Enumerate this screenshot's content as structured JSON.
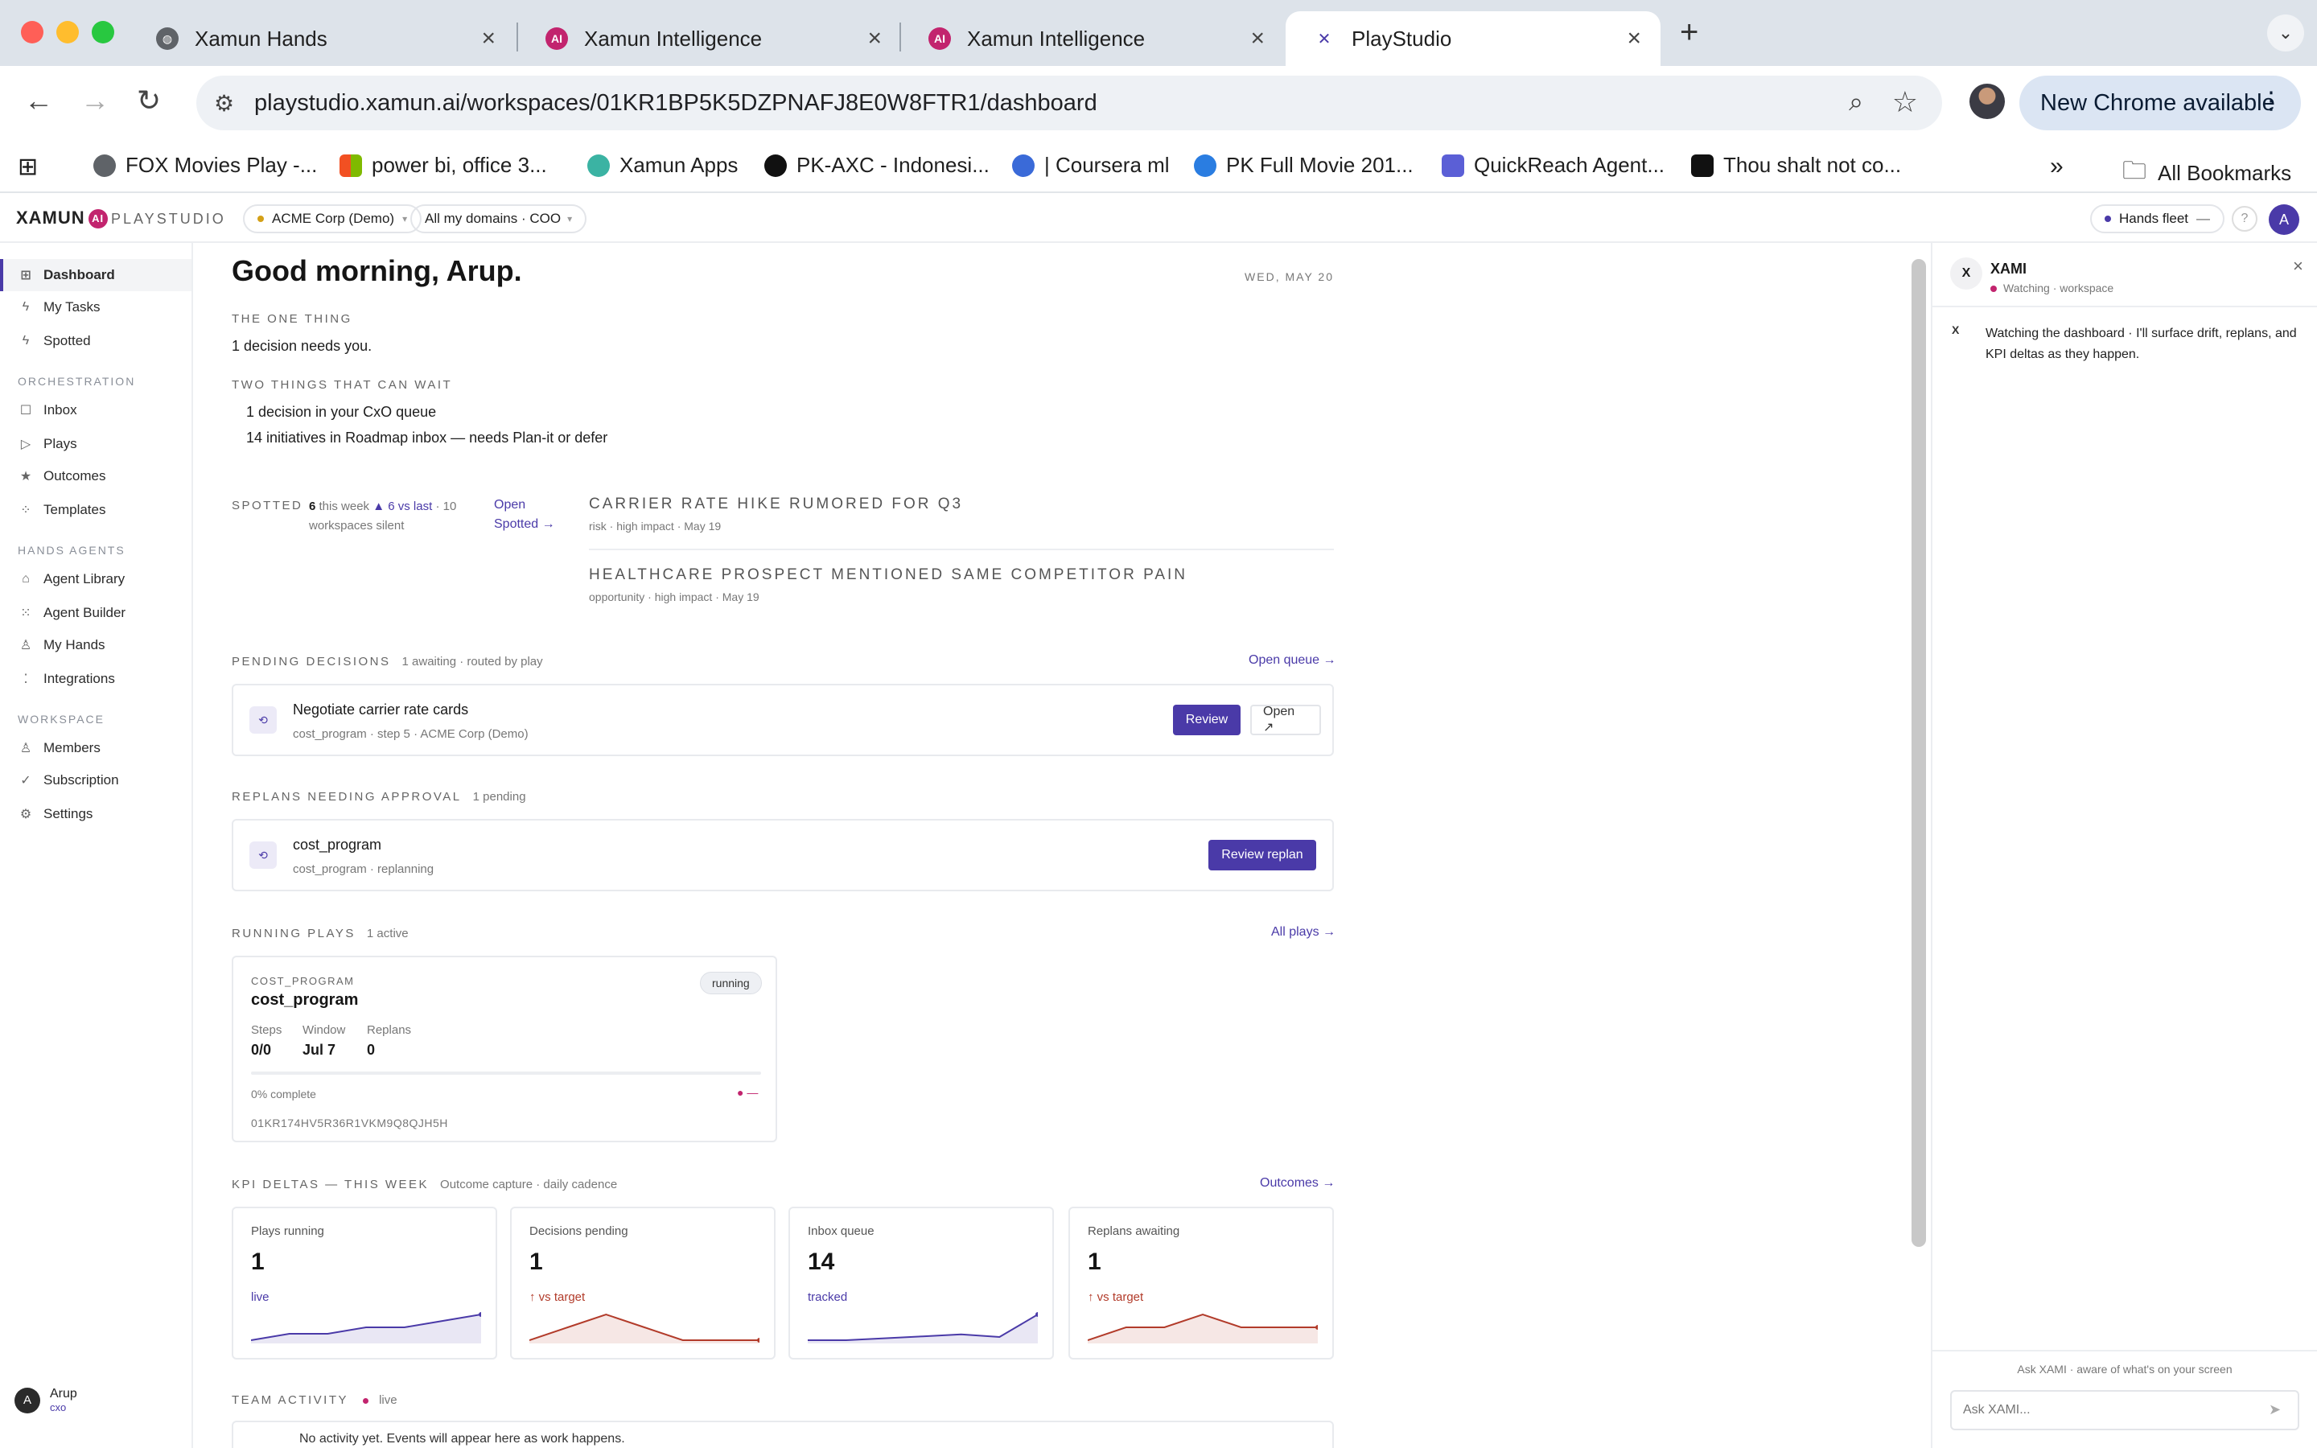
{
  "browser": {
    "tabs": [
      {
        "title": "Xamun Hands",
        "active": false
      },
      {
        "title": "Xamun Intelligence",
        "active": false
      },
      {
        "title": "Xamun Intelligence",
        "active": false
      },
      {
        "title": "PlayStudio",
        "active": true
      }
    ],
    "url": "playstudio.xamun.ai/workspaces/01KR1BP5K5DZPNAFJ8E0W8FTR1/dashboard",
    "update_button": "New Chrome available",
    "bookmarks": [
      "FOX Movies Play -...",
      "power bi, office 3...",
      "Xamun Apps",
      "PK-AXC - Indonesi...",
      "| Coursera ml",
      "PK Full Movie 201...",
      "QuickReach Agent...",
      "Thou shalt not co..."
    ],
    "all_bookmarks": "All Bookmarks"
  },
  "header": {
    "logo": "XAMUN",
    "logo_ai": "AI",
    "product": "PLAYSTUDIO",
    "org": "ACME Corp (Demo)",
    "domains": "All my domains · COO",
    "fleet": "Hands fleet",
    "fleet_status": "—",
    "user_initial": "A"
  },
  "sidebar": {
    "items": [
      {
        "label": "Dashboard",
        "icon": "grid-icon"
      },
      {
        "label": "My Tasks",
        "icon": "bolt-icon"
      },
      {
        "label": "Spotted",
        "icon": "bolt-icon"
      }
    ],
    "sections": [
      {
        "title": "ORCHESTRATION",
        "items": [
          {
            "label": "Inbox",
            "icon": "inbox-icon"
          },
          {
            "label": "Plays",
            "icon": "play-icon"
          },
          {
            "label": "Outcomes",
            "icon": "star-icon"
          },
          {
            "label": "Templates",
            "icon": "template-icon"
          }
        ]
      },
      {
        "title": "HANDS AGENTS",
        "items": [
          {
            "label": "Agent Library",
            "icon": "library-icon"
          },
          {
            "label": "Agent Builder",
            "icon": "builder-icon"
          },
          {
            "label": "My Hands",
            "icon": "user-icon"
          },
          {
            "label": "Integrations",
            "icon": "integrations-icon"
          }
        ]
      },
      {
        "title": "WORKSPACE",
        "items": [
          {
            "label": "Members",
            "icon": "members-icon"
          },
          {
            "label": "Subscription",
            "icon": "check-icon"
          },
          {
            "label": "Settings",
            "icon": "gear-icon"
          }
        ]
      }
    ],
    "user": {
      "initial": "A",
      "name": "Arup",
      "role": "cxo"
    }
  },
  "main": {
    "greeting": "Good morning, Arup.",
    "date": "WED, MAY 20",
    "one_thing": {
      "label": "THE ONE THING",
      "text": "1 decision needs you."
    },
    "can_wait": {
      "label": "TWO THINGS THAT CAN WAIT",
      "items": [
        "1 decision in your CxO queue",
        "14 initiatives in Roadmap inbox — needs Plan-it or defer"
      ]
    },
    "spotted": {
      "label": "SPOTTED",
      "count": "6",
      "count_suffix": "this week",
      "delta": "▲ 6 vs last",
      "silent": "· 10 workspaces silent",
      "link": "Open Spotted →",
      "items": [
        {
          "title": "CARRIER RATE HIKE RUMORED FOR Q3",
          "meta": "risk · high impact · May 19"
        },
        {
          "title": "HEALTHCARE PROSPECT MENTIONED SAME COMPETITOR PAIN",
          "meta": "opportunity · high impact · May 19"
        }
      ]
    },
    "pending": {
      "label": "PENDING DECISIONS",
      "sub": "1 awaiting · routed by play",
      "link": "Open queue →",
      "item": {
        "title": "Negotiate carrier rate cards",
        "meta": "cost_program  ·  step 5  ·  ACME Corp (Demo)",
        "review": "Review",
        "open": "Open ↗"
      }
    },
    "replans": {
      "label": "REPLANS NEEDING APPROVAL",
      "sub": "1 pending",
      "item": {
        "title": "cost_program",
        "meta": "cost_program  ·  replanning",
        "button": "Review replan"
      }
    },
    "running": {
      "label": "RUNNING PLAYS",
      "sub": "1 active",
      "link": "All plays →",
      "play": {
        "kicker": "COST_PROGRAM",
        "title": "cost_program",
        "status": "running",
        "stats": [
          {
            "label": "Steps",
            "value": "0/0"
          },
          {
            "label": "Window",
            "value": "Jul 7"
          },
          {
            "label": "Replans",
            "value": "0"
          }
        ],
        "progress_label": "0% complete",
        "progress": 0,
        "progress_tail": "—",
        "id": "01KR174HV5R36R1VKM9Q8QJH5H"
      }
    },
    "kpi": {
      "label": "KPI DELTAS — THIS WEEK",
      "sub": "Outcome capture · daily cadence",
      "link": "Outcomes →",
      "cards": [
        {
          "label": "Plays running",
          "value": "1",
          "note": "live",
          "tone": "#4a3aa8",
          "trend": [
            1,
            2,
            2,
            3,
            3,
            4,
            5
          ]
        },
        {
          "label": "Decisions pending",
          "value": "1",
          "note": "↑ vs target",
          "tone": "#b23b2a",
          "trend": [
            1,
            3,
            5,
            3,
            1,
            1,
            1
          ]
        },
        {
          "label": "Inbox queue",
          "value": "14",
          "note": "tracked",
          "tone": "#4a3aa8",
          "trend": [
            1,
            1,
            1.3,
            1.6,
            1.9,
            1.5,
            5
          ]
        },
        {
          "label": "Replans awaiting",
          "value": "1",
          "note": "↑ vs target",
          "tone": "#b23b2a",
          "trend": [
            1,
            3,
            3,
            5,
            3,
            3,
            3
          ]
        }
      ]
    },
    "team": {
      "label": "TEAM ACTIVITY",
      "sub": "live",
      "empty": "No activity yet. Events will appear here as work happens."
    }
  },
  "xami": {
    "logo": "X",
    "name": "XAMI",
    "status": "Watching · workspace",
    "message_avatar": "X",
    "message": "Watching the dashboard · I'll surface drift, replans, and KPI deltas as they happen.",
    "hint": "Ask XAMI · aware of what's on your screen",
    "placeholder": "Ask XAMI...",
    "close": "×"
  }
}
